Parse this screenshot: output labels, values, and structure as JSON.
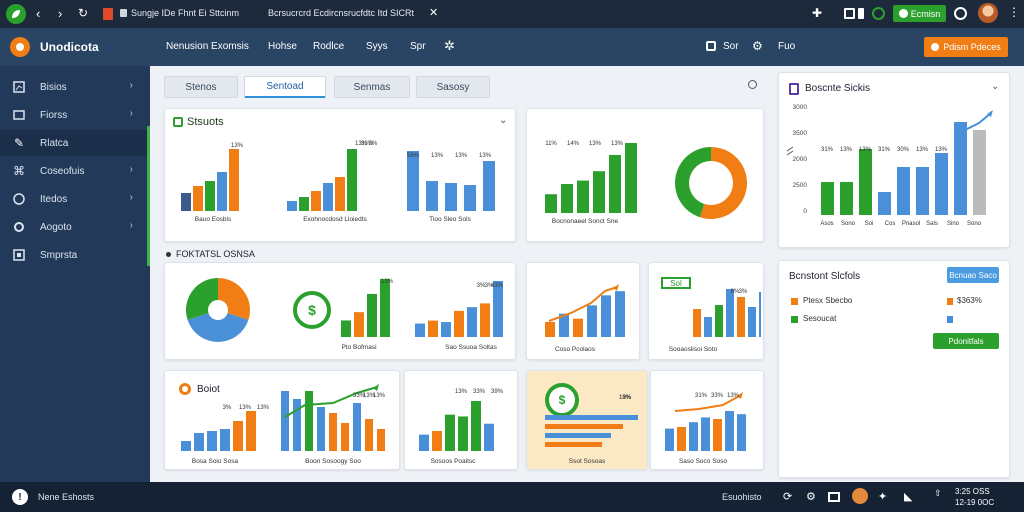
{
  "browser": {
    "tab_title": "Sungje IDe Fhnt Ei Sttcinm",
    "address": "Bcrsucrcrd Ecdircnsrucfdtc Itd SICRt",
    "action_button": "Ecmisn",
    "icons": [
      "leaf-app-icon",
      "back-icon",
      "forward-icon",
      "reload-icon",
      "page-icon",
      "lock-icon",
      "close-tab-icon",
      "puzzle-icon",
      "window-icon",
      "chat-icon",
      "clock-icon",
      "avatar"
    ]
  },
  "app": {
    "brand": "Unodicota",
    "nav": [
      "Nenusion Exomsis",
      "Hohse",
      "Rodlce",
      "Syys",
      "Spr"
    ],
    "right_items": [
      "Sor",
      "Fuo"
    ],
    "primary_button": "Pdism Pdeces"
  },
  "sidebar": {
    "items": [
      {
        "label": "Bisios",
        "icon": "chart-icon",
        "chevron": true
      },
      {
        "label": "Fiorss",
        "icon": "image-icon",
        "chevron": true
      },
      {
        "label": "Rlatca",
        "icon": "tools-icon",
        "chevron": false,
        "active": true
      },
      {
        "label": "Coseofuis",
        "icon": "network-icon",
        "chevron": true
      },
      {
        "label": "Itedos",
        "icon": "globe-icon",
        "chevron": true
      },
      {
        "label": "Aogoto",
        "icon": "settings-icon",
        "chevron": true
      },
      {
        "label": "Smprsta",
        "icon": "grid-icon",
        "chevron": false
      }
    ]
  },
  "tabs": [
    {
      "label": "Stenos"
    },
    {
      "label": "Sentoad",
      "active": true
    },
    {
      "label": "Senmas"
    },
    {
      "label": "Sasosy"
    }
  ],
  "section_title": "FOKTATSL OSNSA",
  "cards": {
    "c1": {
      "title": "Stsuots",
      "dropdown": "chevron-down-icon",
      "chartA": {
        "type": "bar",
        "values": [
          18,
          25,
          30,
          39,
          62
        ],
        "top_label": "13%",
        "tick": "Bauo Eosbis"
      },
      "chartB": {
        "type": "bar",
        "values": [
          10,
          14,
          20,
          28,
          34,
          62
        ],
        "labels": [
          "13%",
          "33%",
          "3%"
        ],
        "tick": "Exohnocdosd Lloiedts"
      }
    },
    "c1b": {
      "chartC": {
        "type": "bar",
        "values": [
          60,
          30,
          28,
          26,
          50
        ],
        "labels": [
          "56%",
          "13%",
          "13%",
          "13%"
        ],
        "tick": "Tioo Sleo Sols"
      }
    },
    "c2": {
      "chart": {
        "type": "bar",
        "values": [
          22,
          34,
          38,
          49,
          68,
          82
        ],
        "labels": [
          "11%",
          "14%",
          "13%",
          "13%"
        ],
        "tick": "Bocnonaeel Sonct Sne"
      },
      "donut": {
        "type": "pie",
        "segments": [
          {
            "value": 55,
            "color": "#f07e15"
          },
          {
            "value": 45,
            "color": "#2ca02c"
          }
        ]
      }
    },
    "c3": {
      "title": "Boscnte Sickis",
      "values": [
        33,
        33,
        66,
        23,
        48,
        48,
        62,
        93,
        85
      ],
      "labels": [
        "31%",
        "13%",
        "13%",
        "31%",
        "30%",
        "13%",
        "13%"
      ],
      "yticks": [
        "3000",
        "3500",
        "2000",
        "2500",
        "0"
      ],
      "ticks": [
        "Asos",
        "Sono",
        "Soi",
        "Cos",
        "Pnasol",
        "Sals",
        "Sino",
        "Sono"
      ]
    },
    "c4": {
      "title": "Bcnstont Slcfols",
      "button": "Bcnuao Saco",
      "rows": [
        {
          "label": "Ptesx Sbecbo",
          "value": "$363%",
          "color": "#f07e15"
        },
        {
          "label": "Sesoucat",
          "value": "",
          "color": "#2ca02c"
        }
      ],
      "cta": "Pdonitfals"
    },
    "c5": {
      "pie": {
        "type": "pie",
        "segments": [
          {
            "value": 30,
            "color": "#f07e15"
          },
          {
            "value": 40,
            "color": "#4a90d9"
          },
          {
            "value": 30,
            "color": "#2ca02c"
          }
        ]
      }
    },
    "c6": {
      "badge": "$",
      "values": [
        20,
        30,
        52,
        70
      ],
      "labels": [
        "13%"
      ],
      "caption": "Pto Bofmasi"
    },
    "c7": {
      "values": [
        18,
        22,
        20,
        35,
        40,
        45,
        75
      ],
      "labels": [
        "3%",
        "3%",
        "43%"
      ],
      "caption": "Sao Ssuoa Soltas"
    },
    "c8": {
      "values": [
        18,
        28,
        22,
        38,
        50,
        55
      ],
      "caption": "Coso Pcolaos"
    },
    "c9": {
      "legend": "Sol",
      "values": [
        28,
        20,
        32,
        48,
        40,
        30,
        45
      ],
      "labels": [
        "8%",
        "3%"
      ],
      "caption": "Sooaoslisoi Soto"
    },
    "c10": {
      "title": "Boiot",
      "values": [
        10,
        18,
        20,
        22,
        30,
        40
      ],
      "labels": [
        "3%",
        "13%",
        "13%"
      ],
      "caption": "Bosa Soio Sosa"
    },
    "c11": {
      "values": [
        60,
        52,
        60,
        44,
        38,
        28,
        48,
        32,
        22
      ],
      "labels": [
        "33%",
        "13%",
        "13%"
      ],
      "caption": "Boon Sosoogy Soo"
    },
    "c12": {
      "values": [
        18,
        22,
        40,
        38,
        55,
        30
      ],
      "labels": [
        "13%",
        "33%",
        "39%"
      ],
      "caption": "Sosoos Poaitsc"
    },
    "c13": {
      "badge": "$",
      "bars": [
        62,
        52,
        44,
        38
      ],
      "labels": [
        "13%",
        "13%",
        "19%"
      ],
      "caption": "Ssot Sosoas"
    },
    "c14": {
      "values": [
        28,
        30,
        36,
        42,
        40,
        50,
        46
      ],
      "labels": [
        "31%",
        "33%",
        "13%"
      ],
      "caption": "Saso Soco Soso"
    }
  },
  "footer": {
    "left_label": "Nene Eshosts",
    "right_label": "Esuohisto",
    "time": "3:25 OSS",
    "date": "12-19 0OC"
  },
  "colors": {
    "blue": "#4a90d9",
    "green": "#2ca02c",
    "orange": "#f07e15",
    "navy": "#22395a",
    "header": "#2a4463",
    "accent_btn": "#f07e15"
  }
}
